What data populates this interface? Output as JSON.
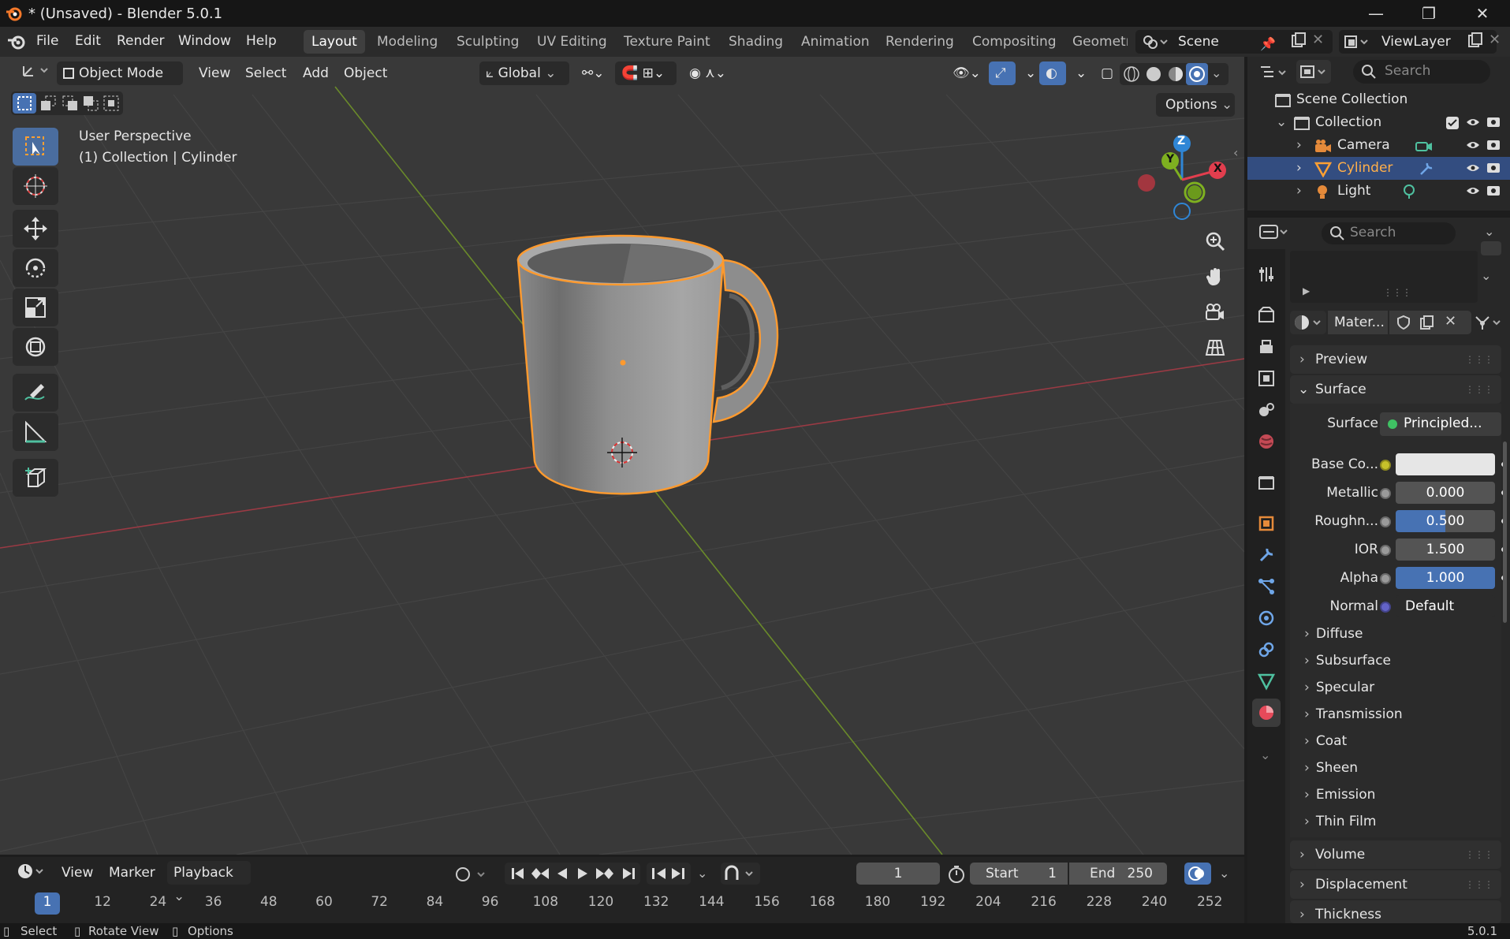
{
  "window": {
    "title": "* (Unsaved) - Blender 5.0.1",
    "minimize": "—",
    "maximize": "❐",
    "close": "✕"
  },
  "menu": [
    "File",
    "Edit",
    "Render",
    "Window",
    "Help"
  ],
  "workspaces": [
    "Layout",
    "Modeling",
    "Sculpting",
    "UV Editing",
    "Texture Paint",
    "Shading",
    "Animation",
    "Rendering",
    "Compositing",
    "Geometr"
  ],
  "scene": {
    "name": "Scene",
    "view_layer": "ViewLayer"
  },
  "viewport_header": {
    "mode": "Object Mode",
    "menus": [
      "View",
      "Select",
      "Add",
      "Object"
    ],
    "orientation": "Global",
    "options": "Options"
  },
  "viewport": {
    "perspective": "User Perspective",
    "context": "(1) Collection | Cylinder",
    "gizmo_labels": {
      "z": "Z",
      "y": "Y",
      "x": "X"
    }
  },
  "outliner": {
    "search_placeholder": "Search",
    "scene_collection": "Scene Collection",
    "collection": "Collection",
    "items": [
      {
        "label": "Camera",
        "selected": false
      },
      {
        "label": "Cylinder",
        "selected": true
      },
      {
        "label": "Light",
        "selected": false
      }
    ]
  },
  "properties": {
    "search_placeholder": "Search",
    "material_name": "Mater...",
    "panels": {
      "preview": "Preview",
      "surface": "Surface"
    },
    "surface": {
      "surface_label": "Surface",
      "surface_value": "Principled...",
      "rows": [
        {
          "label": "Base Co...",
          "value": ""
        },
        {
          "label": "Metallic",
          "value": "0.000",
          "fill": 0
        },
        {
          "label": "Roughn...",
          "value": "0.500",
          "fill": 0.5
        },
        {
          "label": "IOR",
          "value": "1.500",
          "fill": 0
        },
        {
          "label": "Alpha",
          "value": "1.000",
          "fill": 1
        }
      ],
      "normal_label": "Normal",
      "normal_value": "Default",
      "subpanels": [
        "Diffuse",
        "Subsurface",
        "Specular",
        "Transmission",
        "Coat",
        "Sheen",
        "Emission",
        "Thin Film"
      ]
    },
    "more_panels": [
      "Volume",
      "Displacement",
      "Thickness"
    ]
  },
  "timeline": {
    "menus": [
      "View",
      "Marker",
      "Playback"
    ],
    "current_frame": "1",
    "start_label": "Start",
    "start": "1",
    "end_label": "End",
    "end": "250",
    "ticks": [
      "1",
      "12",
      "24",
      "36",
      "48",
      "60",
      "72",
      "84",
      "96",
      "108",
      "120",
      "132",
      "144",
      "156",
      "168",
      "180",
      "192",
      "204",
      "216",
      "228",
      "240",
      "252"
    ]
  },
  "statusbar": {
    "items": [
      "Select",
      "Rotate View",
      "Options"
    ],
    "version": "5.0.1"
  },
  "colors": {
    "accent": "#4772b3",
    "selection": "#ffa033",
    "x_axis": "#e23e4e",
    "y_axis": "#7eb020",
    "z_axis": "#2f86d6"
  }
}
